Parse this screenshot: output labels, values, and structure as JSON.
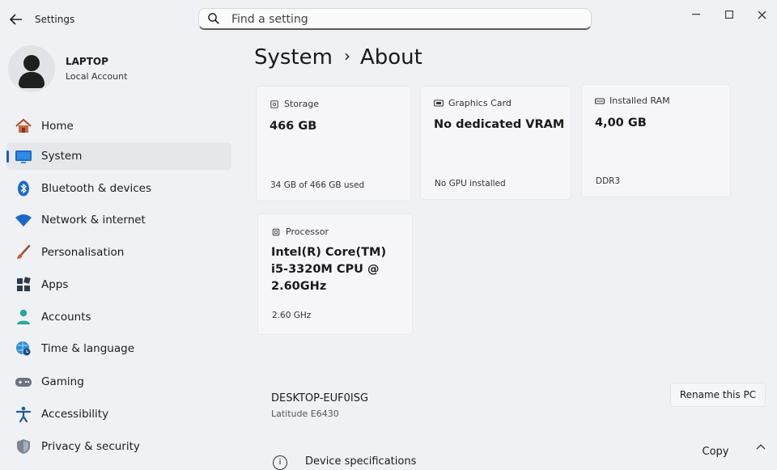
{
  "window": {
    "app_title": "Settings",
    "minimize_icon": "minimize-icon",
    "maximize_icon": "maximize-icon",
    "close_icon": "close-icon"
  },
  "search": {
    "placeholder": "Find a setting",
    "icon": "search-icon"
  },
  "profile": {
    "name": "LAPTOP",
    "account_type": "Local Account"
  },
  "nav": {
    "items": [
      {
        "label": "Home",
        "icon": "home-icon"
      },
      {
        "label": "System",
        "icon": "system-icon",
        "selected": true
      },
      {
        "label": "Bluetooth & devices",
        "icon": "bluetooth-icon"
      },
      {
        "label": "Network & internet",
        "icon": "wifi-icon"
      },
      {
        "label": "Personalisation",
        "icon": "brush-icon"
      },
      {
        "label": "Apps",
        "icon": "apps-icon"
      },
      {
        "label": "Accounts",
        "icon": "accounts-icon"
      },
      {
        "label": "Time & language",
        "icon": "globe-clock-icon"
      },
      {
        "label": "Gaming",
        "icon": "gamepad-icon"
      },
      {
        "label": "Accessibility",
        "icon": "accessibility-icon"
      },
      {
        "label": "Privacy & security",
        "icon": "shield-icon"
      }
    ]
  },
  "header": {
    "section": "System",
    "page": "About",
    "separator": "›"
  },
  "cards": {
    "storage": {
      "title": "Storage",
      "value": "466 GB",
      "detail": "34 GB of 466 GB used",
      "icon": "storage-icon"
    },
    "graphics": {
      "title": "Graphics Card",
      "value": "No dedicated VRAM",
      "detail": "No GPU installed",
      "icon": "graphics-card-icon"
    },
    "ram": {
      "title": "Installed RAM",
      "value": "4,00 GB",
      "detail": "DDR3",
      "icon": "ram-icon"
    },
    "processor": {
      "title": "Processor",
      "value_line1": "Intel(R) Core(TM)",
      "value_line2": "i5-3320M CPU @",
      "value_line3": "2.60GHz",
      "detail": "2.60 GHz",
      "icon": "processor-icon"
    }
  },
  "device": {
    "name": "DESKTOP-EUF0ISG",
    "model": "Latitude E6430",
    "rename_label": "Rename this PC"
  },
  "specs": {
    "title": "Device specifications",
    "copy_label": "Copy"
  },
  "colors": {
    "accent": "#1a5fb4",
    "background": "#f0f1f4",
    "card": "#f6f6f8"
  }
}
